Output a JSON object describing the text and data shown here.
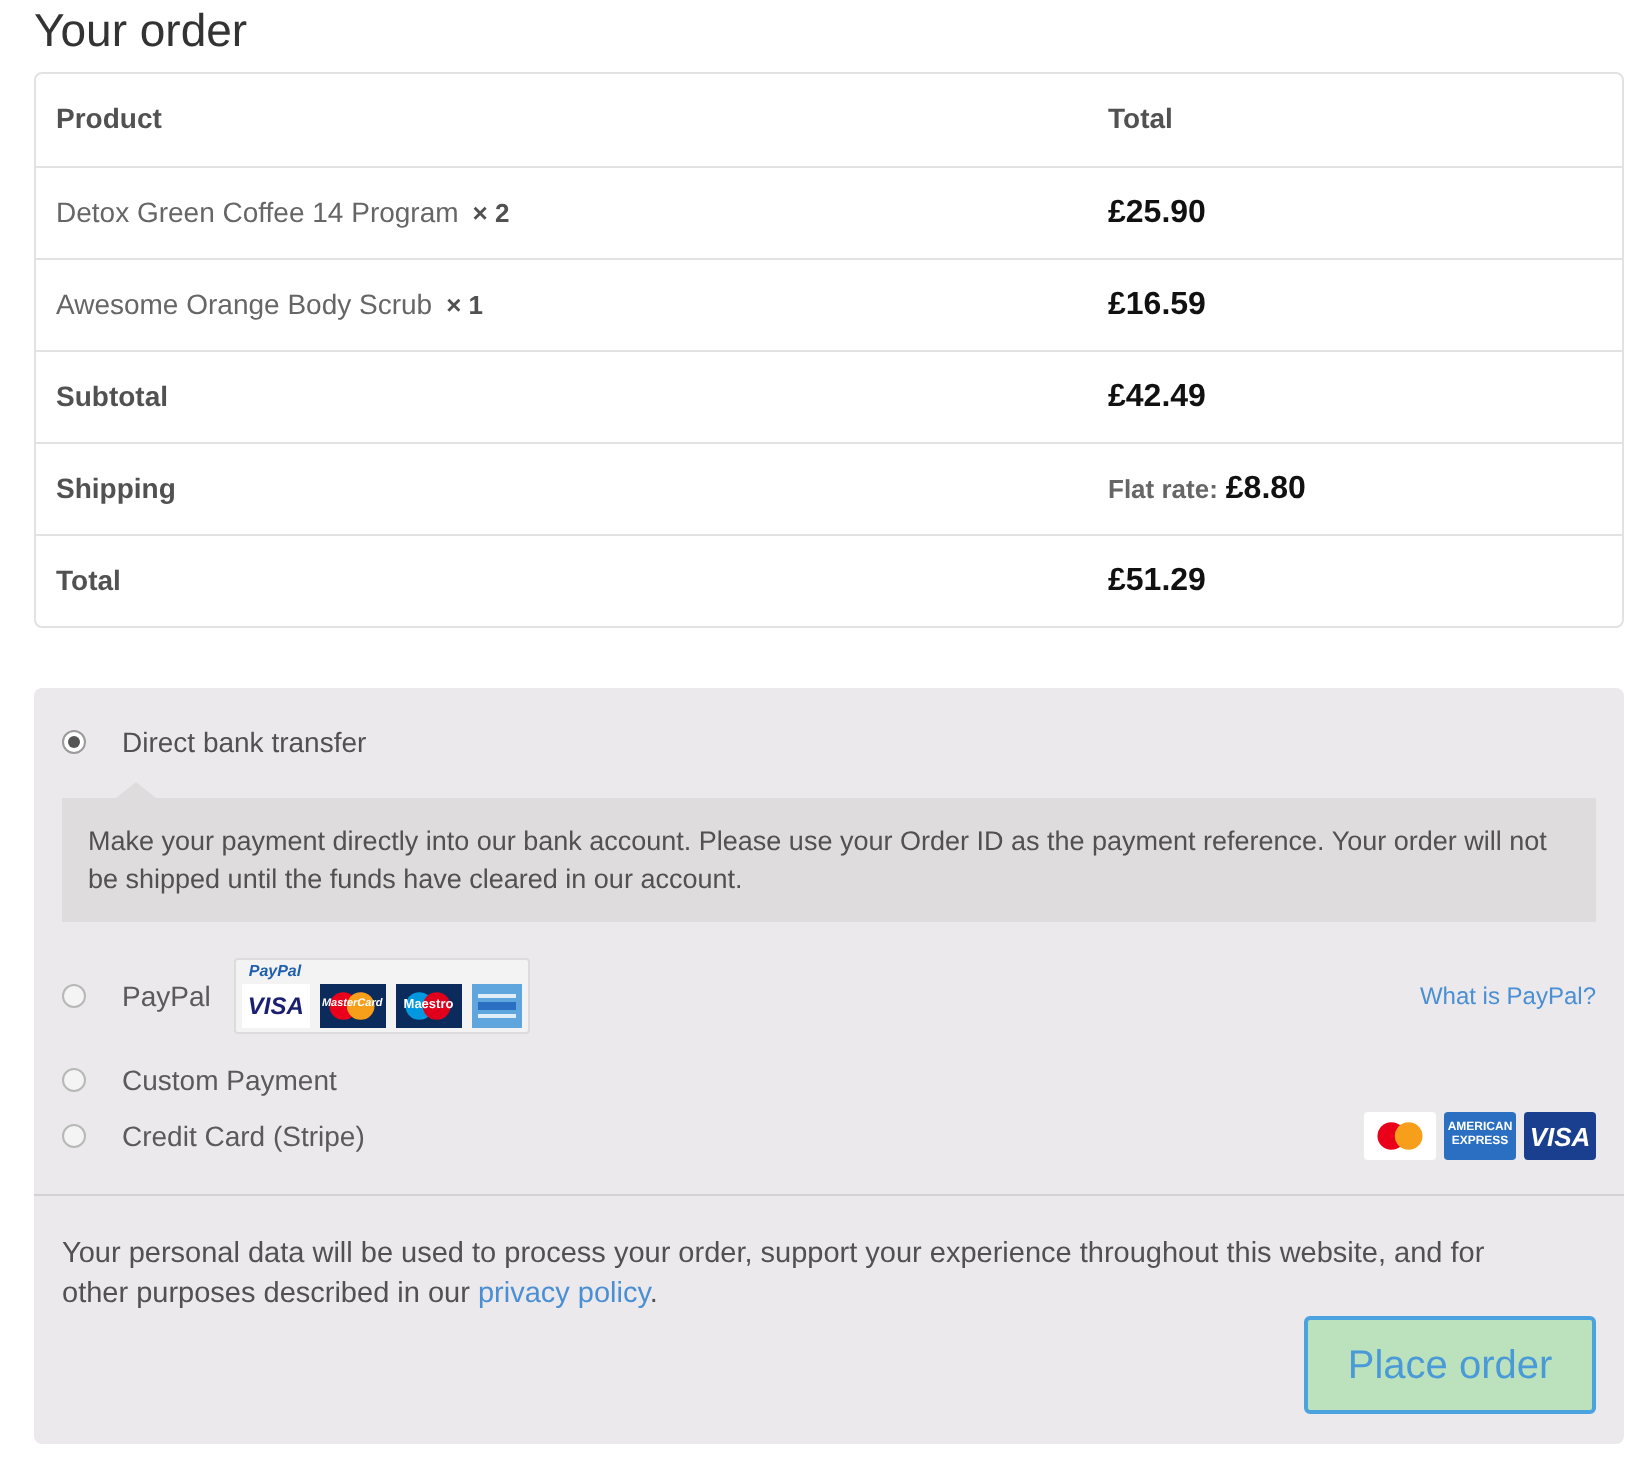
{
  "heading": "Your order",
  "order_table": {
    "columns": [
      "Product",
      "Total"
    ],
    "items": [
      {
        "name": "Detox Green Coffee 14 Program",
        "quantity": "× 2",
        "total": "£25.90"
      },
      {
        "name": "Awesome Orange Body Scrub",
        "quantity": "× 1",
        "total": "£16.59"
      }
    ],
    "totals": [
      {
        "label": "Subtotal",
        "value": "£42.49"
      },
      {
        "label": "Shipping",
        "method": "Flat rate:",
        "value": "£8.80"
      },
      {
        "label": "Total",
        "value": "£51.29"
      }
    ]
  },
  "payment_methods": [
    {
      "label": "Direct bank transfer",
      "selected": true,
      "description": "Make your payment directly into our bank account. Please use your Order ID as the payment reference. Your order will not be shipped until the funds have cleared in our account."
    },
    {
      "label": "PayPal",
      "selected": false,
      "acceptance_mark": {
        "title": "PayPal",
        "cards": [
          {
            "kind": "visa",
            "text": "VISA"
          },
          {
            "kind": "mastercard",
            "text": "MasterCard"
          },
          {
            "kind": "maestro",
            "text": "Maestro"
          },
          {
            "kind": "amex"
          }
        ]
      },
      "link": "What is PayPal?"
    },
    {
      "label": "Custom Payment",
      "selected": false
    },
    {
      "label": "Credit Card (Stripe)",
      "selected": false,
      "card_icons": [
        {
          "kind": "mastercard"
        },
        {
          "kind": "amex",
          "text": "AMERICAN EXPRESS"
        },
        {
          "kind": "visa",
          "text": "VISA"
        }
      ]
    }
  ],
  "privacy_notice": {
    "text": "Your personal data will be used to process your order, support your experience throughout this website, and for other purposes described in our",
    "link": "privacy policy",
    "end": "."
  },
  "place_order_button": "Place order"
}
